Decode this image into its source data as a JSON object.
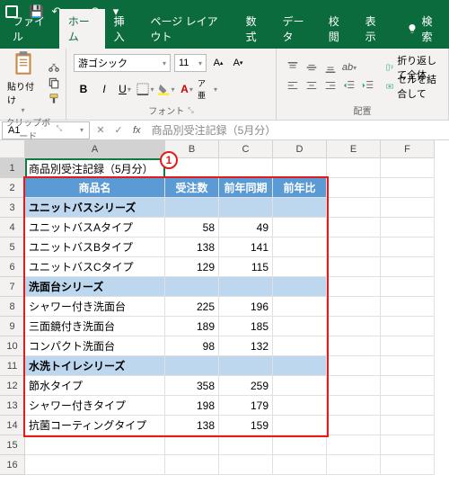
{
  "qat": {
    "save": "💾",
    "undo": "↶",
    "redo": "↷"
  },
  "tabs": {
    "file": "ファイル",
    "home": "ホーム",
    "insert": "挿入",
    "layout": "ページ レイアウト",
    "formulas": "数式",
    "data": "データ",
    "review": "校閲",
    "view": "表示",
    "search": "検索"
  },
  "ribbon": {
    "paste": "貼り付け",
    "clipboard": "クリップボード",
    "font_name": "游ゴシック",
    "font_size": "11",
    "font_label": "フォント",
    "align_label": "配置",
    "wrap": "折り返して全体",
    "merge": "セルを結合して"
  },
  "namebox": "A1",
  "formula": "商品別受注記録（5月分）",
  "cols": [
    "A",
    "B",
    "C",
    "D",
    "E",
    "F"
  ],
  "callout": "1",
  "chart_data": {
    "type": "table",
    "title": "商品別受注記録（5月分）",
    "headers": [
      "商品名",
      "受注数",
      "前年同期",
      "前年比"
    ],
    "rows": [
      {
        "kind": "category",
        "label": "ユニットバスシリーズ"
      },
      {
        "kind": "data",
        "label": "ユニットバスAタイプ",
        "v1": 58,
        "v2": 49
      },
      {
        "kind": "data",
        "label": "ユニットバスBタイプ",
        "v1": 138,
        "v2": 141
      },
      {
        "kind": "data",
        "label": "ユニットバスCタイプ",
        "v1": 129,
        "v2": 115
      },
      {
        "kind": "category",
        "label": "洗面台シリーズ"
      },
      {
        "kind": "data",
        "label": "シャワー付き洗面台",
        "v1": 225,
        "v2": 196
      },
      {
        "kind": "data",
        "label": "三面鏡付き洗面台",
        "v1": 189,
        "v2": 185
      },
      {
        "kind": "data",
        "label": "コンパクト洗面台",
        "v1": 98,
        "v2": 132
      },
      {
        "kind": "category",
        "label": "水洗トイレシリーズ"
      },
      {
        "kind": "data",
        "label": "節水タイプ",
        "v1": 358,
        "v2": 259
      },
      {
        "kind": "data",
        "label": "シャワー付きタイプ",
        "v1": 198,
        "v2": 179
      },
      {
        "kind": "data",
        "label": "抗菌コーティングタイプ",
        "v1": 138,
        "v2": 159
      }
    ]
  }
}
